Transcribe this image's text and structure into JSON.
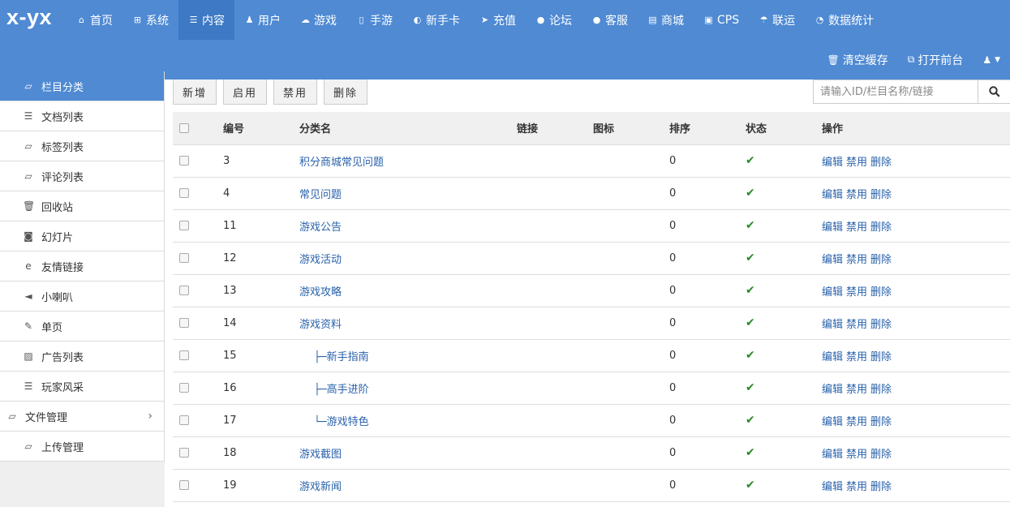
{
  "logo": "x-yx",
  "nav": [
    {
      "label": "首页",
      "icon": "home-icon",
      "glyph": "⌂"
    },
    {
      "label": "系统",
      "icon": "windows-icon",
      "glyph": "⊞"
    },
    {
      "label": "内容",
      "icon": "list-icon",
      "glyph": "☰",
      "active": true
    },
    {
      "label": "用户",
      "icon": "users-icon",
      "glyph": "♟"
    },
    {
      "label": "游戏",
      "icon": "cloud-icon",
      "glyph": "☁"
    },
    {
      "label": "手游",
      "icon": "mobile-icon",
      "glyph": "▯"
    },
    {
      "label": "新手卡",
      "icon": "firefox-icon",
      "glyph": "◐"
    },
    {
      "label": "充值",
      "icon": "send-icon",
      "glyph": "➤"
    },
    {
      "label": "论坛",
      "icon": "comment-icon",
      "glyph": "●"
    },
    {
      "label": "客服",
      "icon": "comments-icon",
      "glyph": "●"
    },
    {
      "label": "商城",
      "icon": "book-icon",
      "glyph": "▤"
    },
    {
      "label": "CPS",
      "icon": "cps-icon",
      "glyph": "▣"
    },
    {
      "label": "联运",
      "icon": "umbrella-icon",
      "glyph": "☂"
    },
    {
      "label": "数据统计",
      "icon": "dashboard-icon",
      "glyph": "◔"
    }
  ],
  "top_actions": {
    "clear_cache": "清空缓存",
    "open_front": "打开前台"
  },
  "sidebar": [
    {
      "label": "栏目分类",
      "icon": "folder-open-icon",
      "glyph": "▱",
      "active": true
    },
    {
      "label": "文档列表",
      "icon": "list-icon",
      "glyph": "☰"
    },
    {
      "label": "标签列表",
      "icon": "folder-open-icon",
      "glyph": "▱"
    },
    {
      "label": "评论列表",
      "icon": "folder-open-icon",
      "glyph": "▱"
    },
    {
      "label": "回收站",
      "icon": "trash-icon",
      "glyph": "🗑"
    },
    {
      "label": "幻灯片",
      "icon": "camera-icon",
      "glyph": "◙"
    },
    {
      "label": "友情链接",
      "icon": "ie-icon",
      "glyph": "e"
    },
    {
      "label": "小喇叭",
      "icon": "bullhorn-icon",
      "glyph": "◄"
    },
    {
      "label": "单页",
      "icon": "edit-icon",
      "glyph": "✎"
    },
    {
      "label": "广告列表",
      "icon": "picture-icon",
      "glyph": "▨"
    },
    {
      "label": "玩家风采",
      "icon": "list-icon",
      "glyph": "☰"
    },
    {
      "label": "文件管理",
      "icon": "folder-open-icon",
      "glyph": "▱",
      "parent": true
    },
    {
      "label": "上传管理",
      "icon": "folder-open-icon",
      "glyph": "▱"
    }
  ],
  "toolbar": {
    "add": "新增",
    "enable": "启用",
    "disable": "禁用",
    "delete": "删除"
  },
  "search": {
    "placeholder": "请输入ID/栏目名称/链接"
  },
  "table": {
    "headers": {
      "id": "编号",
      "name": "分类名",
      "link": "链接",
      "icon": "图标",
      "sort": "排序",
      "status": "状态",
      "ops": "操作"
    },
    "op_labels": {
      "edit": "编辑",
      "disable": "禁用",
      "delete": "删除"
    },
    "status_glyph": "✔",
    "rows": [
      {
        "id": "3",
        "name": "积分商城常见问题",
        "tree": "",
        "sort": "0"
      },
      {
        "id": "4",
        "name": "常见问题",
        "tree": "",
        "sort": "0"
      },
      {
        "id": "11",
        "name": "游戏公告",
        "tree": "",
        "sort": "0"
      },
      {
        "id": "12",
        "name": "游戏活动",
        "tree": "",
        "sort": "0"
      },
      {
        "id": "13",
        "name": "游戏攻略",
        "tree": "",
        "sort": "0"
      },
      {
        "id": "14",
        "name": "游戏资料",
        "tree": "",
        "sort": "0"
      },
      {
        "id": "15",
        "name": "新手指南",
        "tree": "├─",
        "sort": "0"
      },
      {
        "id": "16",
        "name": "高手进阶",
        "tree": "├─",
        "sort": "0"
      },
      {
        "id": "17",
        "name": "游戏特色",
        "tree": "└─",
        "sort": "0"
      },
      {
        "id": "18",
        "name": "游戏截图",
        "tree": "",
        "sort": "0"
      },
      {
        "id": "19",
        "name": "游戏新闻",
        "tree": "",
        "sort": "0"
      }
    ]
  }
}
